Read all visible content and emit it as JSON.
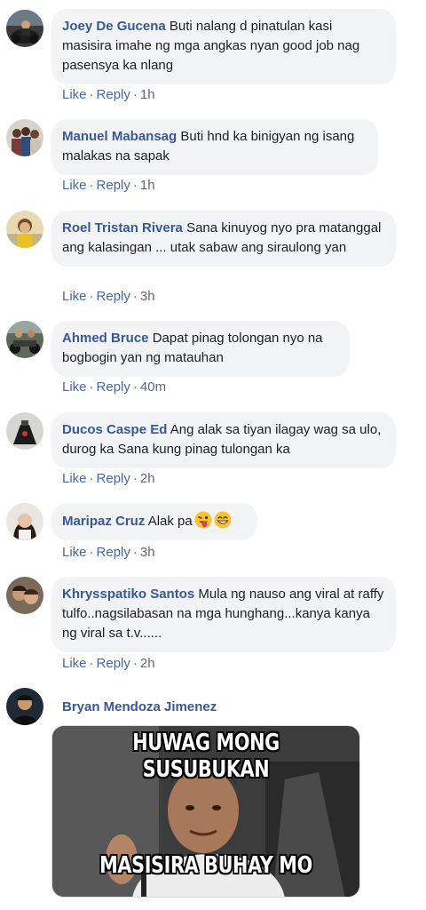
{
  "actions": {
    "like": "Like",
    "reply": "Reply",
    "dot": "·"
  },
  "comments": [
    {
      "author": "Joey De Gucena",
      "text": "Buti nalang d pinatulan kasi masisira imahe ng mga angkas nyan good job nag pasensya ka nlang",
      "time": "1h",
      "avatar_icon": "motorcycle-rider-photo"
    },
    {
      "author": "Manuel Mabansag",
      "text": "Buti hnd ka binigyan ng isang malakas na sapak",
      "time": "1h",
      "avatar_icon": "group-photo"
    },
    {
      "author": "Roel Tristan Rivera",
      "text": "Sana kinuyog nyo pra matanggal ang kalasingan ... utak sabaw ang siraulong yan",
      "time": "3h",
      "avatar_icon": "child-photo"
    },
    {
      "author": "Ahmed Bruce",
      "text": "Dapat pinag tolongan nyo na bogbogin yan ng matauhan",
      "time": "40m",
      "avatar_icon": "motorcycle-group-photo"
    },
    {
      "author": "Ducos Caspe Ed",
      "text": "Ang alak sa tiyan ilagay wag sa ulo, durog ka Sana kung pinag tulongan ka",
      "time": "2h",
      "avatar_icon": "motorbike-photo"
    },
    {
      "author": "Maripaz Cruz",
      "text": "Alak pa",
      "time": "3h",
      "avatar_icon": "woman-portrait-photo",
      "emojis": [
        "winking-tongue-emoji",
        "grinning-emoji"
      ]
    },
    {
      "author": "Khrysspatiko Santos",
      "text": "Mula ng nauso ang viral at raffy tulfo..nagsilabasan na mga hunghang...kanya kanya ng viral sa t.v......",
      "time": "2h",
      "avatar_icon": "couple-photo"
    },
    {
      "author": "Bryan Mendoza Jimenez",
      "text": "",
      "time": "",
      "avatar_icon": "man-portrait-photo",
      "meme": {
        "top_text": "HUWAG MONG SUSUBUKAN",
        "bottom_text": "MASISIRA BUHAY MO"
      }
    }
  ],
  "colors": {
    "author": "#385898",
    "link": "#4267b2",
    "meta": "#606770",
    "bubble": "#f2f3f5"
  }
}
